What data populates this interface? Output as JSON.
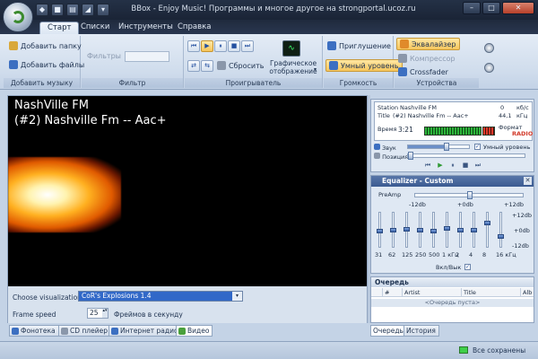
{
  "window": {
    "title": "BBox - Enjoy Music! Программы и многое другое на strongportal.ucoz.ru",
    "controls": {
      "minimize": "–",
      "maximize": "□",
      "close": "✕"
    }
  },
  "qat": [
    "◆",
    "■",
    "▤",
    "◢",
    "▾"
  ],
  "tabs": [
    {
      "label": "Старт",
      "active": true
    },
    {
      "label": "Списки",
      "active": false
    },
    {
      "label": "Инструменты",
      "active": false
    },
    {
      "label": "Справка",
      "active": false
    }
  ],
  "ribbon": {
    "add_music": {
      "label": "Добавить музыку",
      "add_folder": "Добавить папку",
      "add_files": "Добавить файлы"
    },
    "filter": {
      "label": "Фильтр",
      "filters": "Фильтры"
    },
    "player": {
      "label": "Проигрыватель",
      "reset": "Сбросить",
      "graphic_display": "Графическое отображение",
      "graphic_display_arrow": "▾",
      "buttons": {
        "prev": "⏮",
        "play": "▶",
        "pause": "⏸",
        "stop": "■",
        "next": "⏭",
        "repeat": "⇄",
        "shuffle": "⇆"
      }
    },
    "volume": {
      "label": "Громкость",
      "mute": "Приглушение",
      "smart_level": "Умный уровень"
    },
    "devices": {
      "label": "Устройства",
      "equalizer": "Эквалайзер",
      "compressor": "Компрессор",
      "crossfader": "Crossfader"
    }
  },
  "visualization": {
    "line1": "NashVille FM",
    "line2": "(#2) Nashville Fm -- Aac+",
    "choose_label": "Choose visualization",
    "selected": "CoR's Explosions 1.4",
    "select_arrow": "▾",
    "frame_speed_label": "Frame speed",
    "frame_speed_value": "25",
    "spin": "▴▾",
    "fps_label": "Фреймов в секунду"
  },
  "bottom_tabs": [
    {
      "label": "Фонотека",
      "active": false
    },
    {
      "label": "CD плейер",
      "active": false
    },
    {
      "label": "Интернет радио",
      "active": false
    },
    {
      "label": "Видео",
      "active": true
    }
  ],
  "now_playing": {
    "station_label": "Station",
    "station_value": "Nashville FM",
    "title_label": "Title",
    "title_value": "(#2) Nashville Fm -- Aac+",
    "kbps_value": "0",
    "kbps_unit": "кб/с",
    "khz_value": "44,1",
    "khz_unit": "кГц",
    "time_label": "Время",
    "time_value": "3:21",
    "format_label": "Формат",
    "format_value": "RADIO",
    "sound_label": "Звук",
    "smart_level_label": "Умный уровень",
    "position_label": "Позиция",
    "volume_level": 0.62,
    "position_level": 0.0,
    "check_mark": "✓",
    "buttons": {
      "prev": "⏮",
      "play": "▶",
      "pause": "⏸",
      "stop": "■",
      "next": "⏭"
    }
  },
  "equalizer": {
    "title": "Equalizer - Custom",
    "preamp_label": "PreAmp",
    "scale": [
      "-12db",
      "+0db",
      "+12db"
    ],
    "right_scale": [
      "+12db",
      "+0db",
      "-12db"
    ],
    "bands": [
      "31",
      "62",
      "125",
      "250",
      "500",
      "1 кГц",
      "2",
      "4",
      "8",
      "16 кГц"
    ],
    "band_levels": [
      0.45,
      0.5,
      0.52,
      0.48,
      0.47,
      0.55,
      0.5,
      0.5,
      0.72,
      0.28
    ],
    "preamp_level": 0.5,
    "enable_label": "Вкл/Вык",
    "check_mark": "✓",
    "close": "✕"
  },
  "queue": {
    "title": "Очередь",
    "columns": [
      "#",
      "Artist",
      "Title",
      "Alb"
    ],
    "empty": "<Очередь пуста>"
  },
  "right_tabs": [
    {
      "label": "Очередь",
      "active": true
    },
    {
      "label": "История",
      "active": false
    }
  ],
  "status": {
    "saved": "Все сохранены"
  }
}
